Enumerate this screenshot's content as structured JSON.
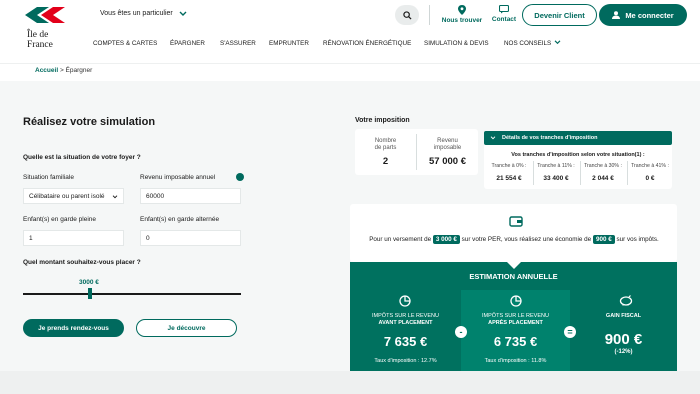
{
  "header": {
    "logo_line1": "Île de",
    "logo_line2": "France",
    "audience": "Vous êtes un particulier",
    "nous_trouver": "Nous trouver",
    "contact": "Contact",
    "devenir_client": "Devenir Client",
    "me_connecter": "Me connecter"
  },
  "nav": {
    "items": [
      "COMPTES & CARTES",
      "ÉPARGNER",
      "S'ASSURER",
      "EMPRUNTER",
      "RÉNOVATION ÉNERGÉTIQUE",
      "SIMULATION & DEVIS",
      "NOS CONSEILS"
    ]
  },
  "breadcrumb": {
    "home": "Accueil",
    "sep": ">",
    "current": "Épargner"
  },
  "form": {
    "title": "Réalisez votre simulation",
    "q_foyer": "Quelle est la situation de votre foyer ?",
    "situation_label": "Situation familiale",
    "situation_value": "Célibataire ou parent isolé",
    "revenu_label": "Revenu imposable annuel",
    "revenu_value": "60000",
    "enfants_pleine_label": "Enfant(s) en garde pleine",
    "enfants_pleine_value": "1",
    "enfants_alt_label": "Enfant(s) en garde alternée",
    "enfants_alt_value": "0",
    "q_montant": "Quel montant souhaitez-vous placer ?",
    "slider_value": "3000 €",
    "btn_rdv": "Je prends rendez-vous",
    "btn_decouvre": "Je découvre"
  },
  "imposition": {
    "title": "Votre imposition",
    "parts_label_1": "Nombre",
    "parts_label_2": "de parts",
    "parts_value": "2",
    "revenu_label_1": "Revenu",
    "revenu_label_2": "imposable",
    "revenu_value": "57 000 €",
    "tranches_header": "Détails de vos tranches d'imposition",
    "tranches_sub": "Vos tranches d'imposition selon votre situation(1) :",
    "tranches": [
      {
        "label": "Tranche à 0% :",
        "value": "21 554 €"
      },
      {
        "label": "Tranche à 11% :",
        "value": "33 400 €"
      },
      {
        "label": "Tranche à 30% :",
        "value": "2 044 €"
      },
      {
        "label": "Tranche à 41% :",
        "value": "0 €"
      }
    ]
  },
  "message": {
    "part1": "Pour un versement de",
    "amount": "3 000 €",
    "part2": "sur votre PER, vous réalisez une économie de",
    "saving": "900 €",
    "part3": "sur vos impôts."
  },
  "estimation": {
    "title": "ESTIMATION ANNUELLE",
    "avant_label_1": "IMPÔTS SUR LE REVENU",
    "avant_label_2": "AVANT PLACEMENT",
    "avant_value": "7 635 €",
    "avant_taux": "Taux d'imposition : 12.7%",
    "apres_label_1": "IMPÔTS SUR LE REVENU",
    "apres_label_2": "APRÈS PLACEMENT",
    "apres_value": "6 735 €",
    "apres_taux": "Taux d'imposition : 11.8%",
    "gain_label": "GAIN FISCAL",
    "gain_value": "900 €",
    "gain_pct": "(-12%)",
    "minus": "-",
    "equals": "="
  },
  "colors": {
    "brand": "#006a5e",
    "estimation_bg": "#00715f",
    "logo_red": "#e2001a"
  }
}
